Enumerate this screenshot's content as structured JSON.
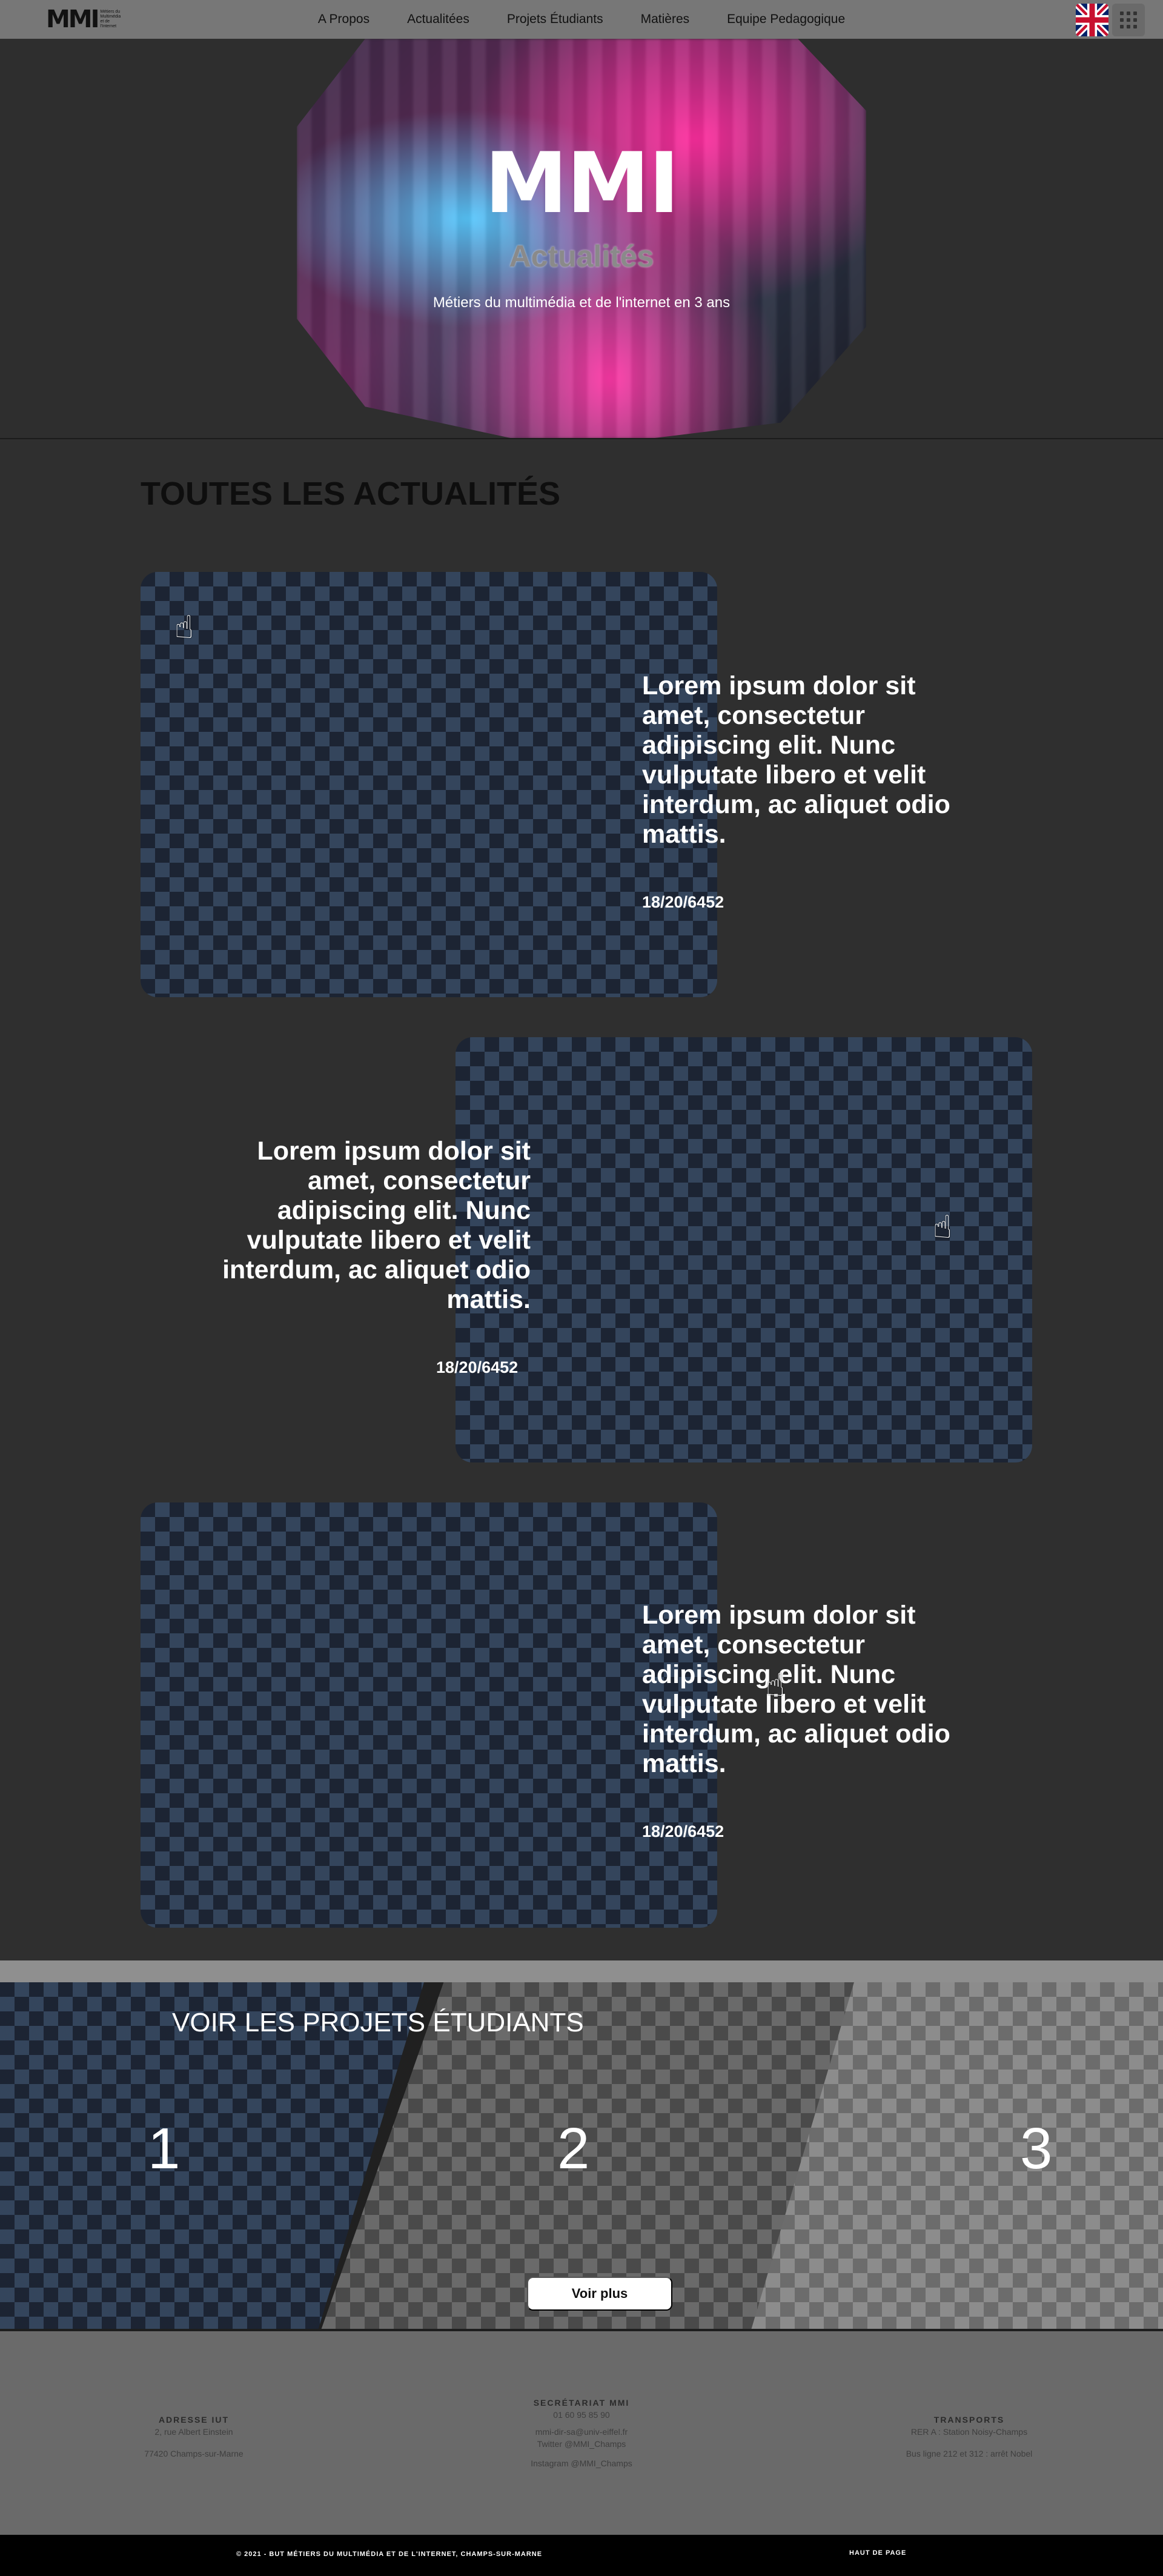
{
  "nav": {
    "logo_mark": "MMI",
    "logo_sub": "Métiers du Multimédia et de l'Internet",
    "links": [
      "A Propos",
      "Actualitées",
      "Projets Étudiants",
      "Matières",
      "Equipe Pedagogique"
    ],
    "language_flag_icon": "uk-flag-icon",
    "menu_icon": "grid-menu-icon"
  },
  "hero": {
    "title": "MMI",
    "subtitle": "Actualités",
    "tagline": "Métiers du multimédia et de l'internet en 3 ans"
  },
  "news": {
    "section_title": "TOUTES LES ACTUALITÉS",
    "items": [
      {
        "text": "Lorem ipsum dolor sit amet, consectetur adipiscing elit. Nunc vulputate libero et velit interdum, ac aliquet odio mattis.",
        "date": "18/20/6452"
      },
      {
        "text": "Lorem ipsum dolor sit amet, consectetur adipiscing elit. Nunc vulputate libero et velit interdum, ac aliquet odio mattis.",
        "date": "18/20/6452"
      },
      {
        "text": "Lorem ipsum dolor sit amet, consectetur adipiscing elit. Nunc vulputate libero et velit interdum, ac aliquet odio mattis.",
        "date": "18/20/6452"
      }
    ]
  },
  "projects": {
    "title": "VOIR LES PROJETS ÉTUDIANTS",
    "numbers": [
      "1",
      "2",
      "3"
    ],
    "button_label": "Voir plus"
  },
  "footer": {
    "address": {
      "heading": "ADRESSE IUT",
      "line1": "2, rue Albert Einstein",
      "line2": "77420 Champs-sur-Marne"
    },
    "secretariat": {
      "heading": "SECRÉTARIAT MMI",
      "phone": "01 60 95 85 90",
      "email": "mmi-dir-sa@univ-eiffel.fr",
      "twitter": "Twitter @MMI_Champs",
      "instagram": "Instagram @MMI_Champs"
    },
    "transports": {
      "heading": "TRANSPORTS",
      "line1": "RER A : Station Noisy-Champs",
      "line2": "Bus ligne 212 et 312 : arrêt Nobel"
    },
    "copyright": "© 2021 - BUT MÉTIERS DU MULTIMÉDIA ET DE L'INTERNET, CHAMPS-SUR-MARNE",
    "back_to_top": "HAUT DE PAGE"
  }
}
